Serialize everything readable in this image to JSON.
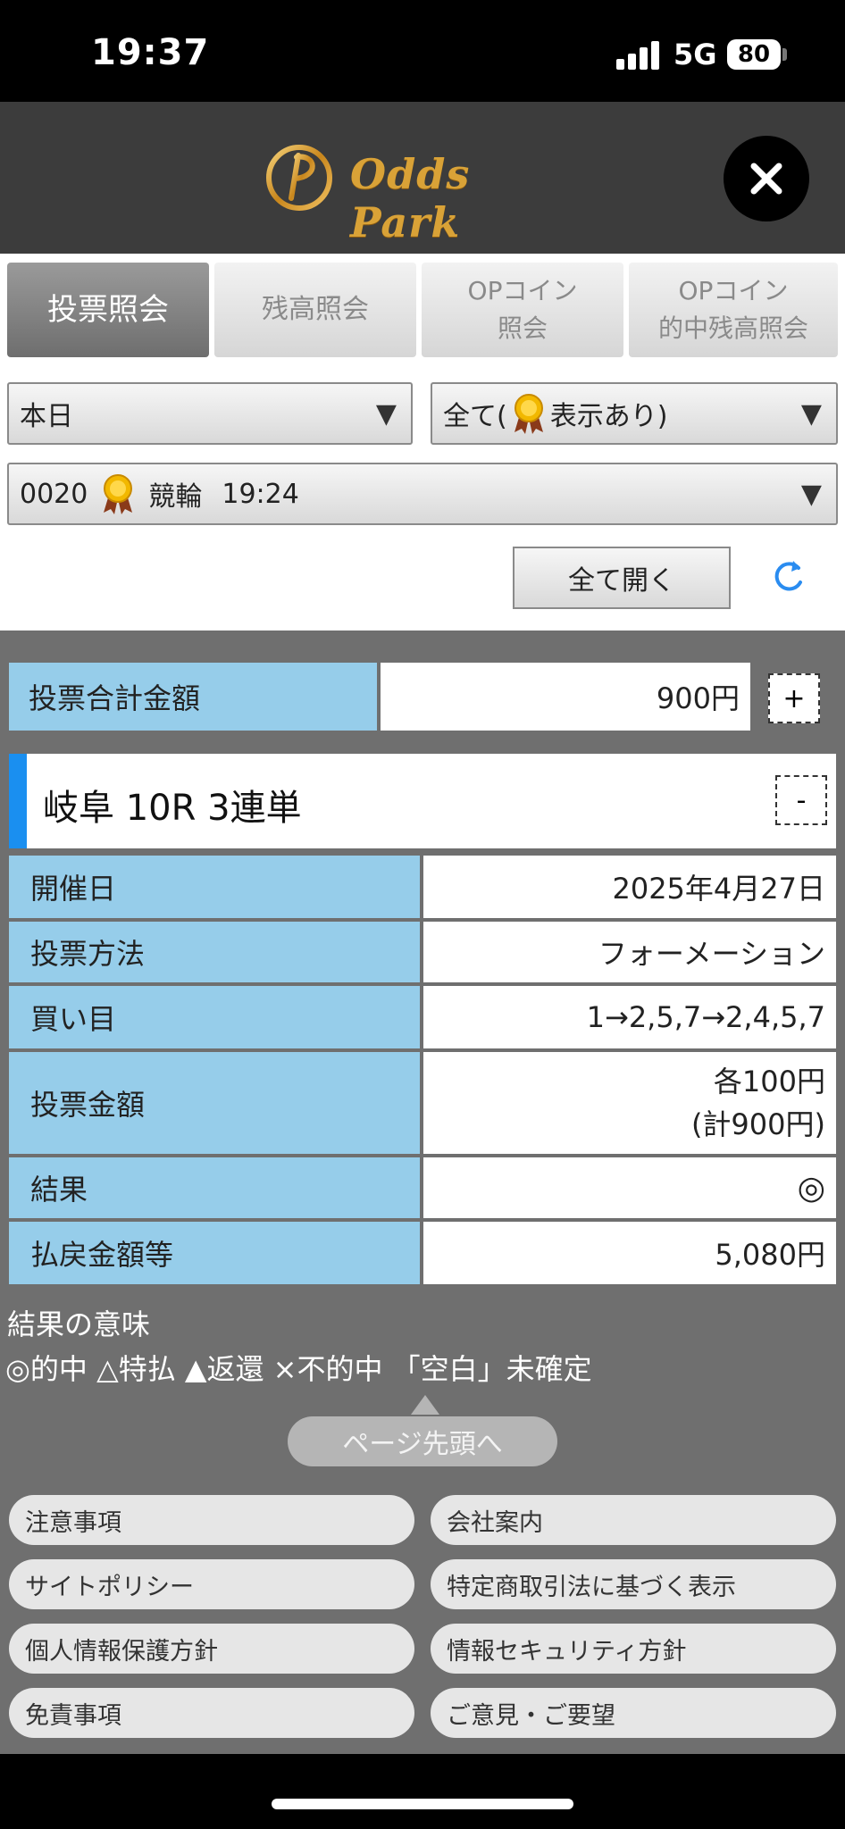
{
  "status_bar": {
    "time": "19:37",
    "network": "5G",
    "battery": "80"
  },
  "header": {
    "logo_text": "Odds Park"
  },
  "tabs": [
    {
      "label": "投票照会"
    },
    {
      "label": "残高照会"
    },
    {
      "label": "OPコイン\n照会"
    },
    {
      "label": "OPコイン\n的中残高照会"
    }
  ],
  "filters": {
    "date": "本日",
    "display_prefix": "全て(",
    "display_suffix": "表示あり)",
    "ticket_number": "0020",
    "ticket_type": "競輪",
    "ticket_time": "19:24",
    "arrow": "▼"
  },
  "actions": {
    "open_all": "全て開く"
  },
  "total": {
    "label": "投票合計金額",
    "value": "900円",
    "expand": "+"
  },
  "race": {
    "title": "岐阜 10R 3連単",
    "collapse": "-"
  },
  "details": [
    {
      "label": "開催日",
      "value": "2025年4月27日"
    },
    {
      "label": "投票方法",
      "value": "フォーメーション"
    },
    {
      "label": "買い目",
      "value": "1→2,5,7→2,4,5,7"
    },
    {
      "label": "投票金額",
      "value": "各100円",
      "value2": "(計900円)"
    },
    {
      "label": "結果",
      "value": "◎"
    },
    {
      "label": "払戻金額等",
      "value": "5,080円"
    }
  ],
  "legend": {
    "title": "結果の意味",
    "line": "◎的中 △特払 ▲返還 ×不的中 「空白」未確定"
  },
  "page_top": "ページ先頭へ",
  "footer_links": [
    "注意事項",
    "会社案内",
    "サイトポリシー",
    "特定商取引法に基づく表示",
    "個人情報保護方針",
    "情報セキュリティ方針",
    "免責事項",
    "ご意見・ご要望"
  ],
  "colors": {
    "label_bg": "#96cdea",
    "accent_bar": "#1a8ff0",
    "logo_gold": "#d9a237",
    "content_bg": "#6f6f6f"
  }
}
